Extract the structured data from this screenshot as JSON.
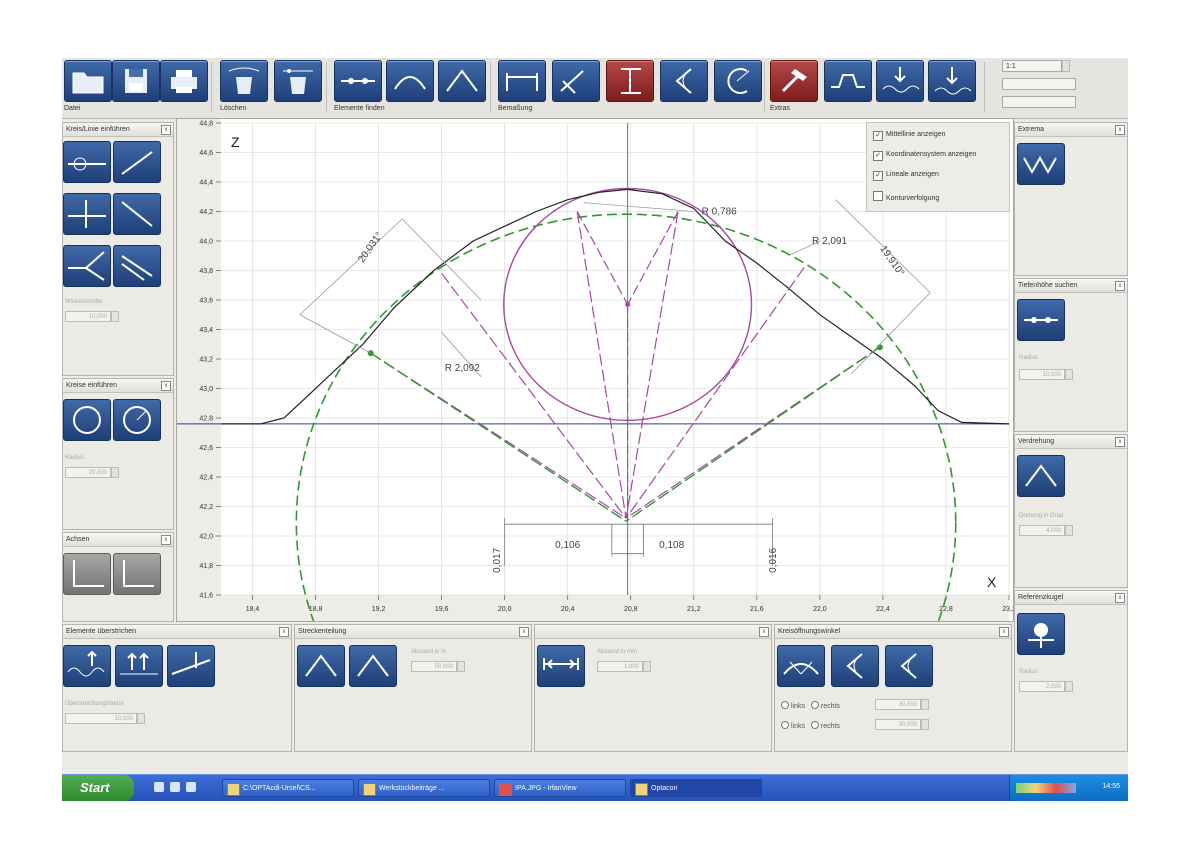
{
  "toolbar": {
    "groups": [
      "Datei",
      "Löschen",
      "Elemente finden",
      "Bemaßung",
      "Extras"
    ],
    "scale_value": "1:1"
  },
  "overlay": {
    "options": [
      {
        "label": "Mittellinie anzeigen",
        "checked": true
      },
      {
        "label": "Koordinatensystem anzeigen",
        "checked": true
      },
      {
        "label": "Lineale anzeigen",
        "checked": true
      },
      {
        "label": "Konturverfolgung",
        "checked": false
      }
    ],
    "check_mark": "✓"
  },
  "left_panels": [
    {
      "title": "Kreis/Linie einführen",
      "field_label": "Winkelschritte",
      "value": "10,000"
    },
    {
      "title": "Kreise einführen",
      "field_label": "Radius",
      "value": "20,000"
    },
    {
      "title": "Achsen",
      "field_label": "",
      "value": ""
    }
  ],
  "right_panels": [
    {
      "title": "Extrema",
      "field_label": "",
      "value": ""
    },
    {
      "title": "Tiefenhöhe suchen",
      "field_label": "Radius",
      "value": "10,000"
    },
    {
      "title": "Verdrehung",
      "field_label": "Drehung in Grad",
      "value": "4,000"
    },
    {
      "title": "Referenzkugel",
      "field_label": "Radius",
      "value": "2,000"
    }
  ],
  "bottom_panels": [
    {
      "title": "Elemente überstrichen",
      "field_label": "Überstreichungsfaktor",
      "value": "10,000"
    },
    {
      "title": "Streckenteilung",
      "field_label": "Abstand in %",
      "value": "50,000"
    },
    {
      "title": "",
      "field_label": "Abstand in mm",
      "value": "1,000"
    },
    {
      "title": "Kreisöffnungswinkel",
      "field_label": "",
      "value": ""
    }
  ],
  "bottom_radio": {
    "left_label": "links",
    "right_label": "rechts",
    "row1_value": "30,000",
    "row2_value": "30,000"
  },
  "taskbar": {
    "start": "Start",
    "tasks": [
      "C:\\OPTAcdi-Ursel\\CS...",
      "Werkstückbeiträge ...",
      "IPA.JPG - IrfanView",
      "Optacon"
    ],
    "clock": "14:55"
  },
  "chart_data": {
    "type": "line",
    "xlabel": "X",
    "ylabel": "Z",
    "xlim": [
      18.2,
      23.2
    ],
    "ylim": [
      41.6,
      44.8
    ],
    "x_ticks": [
      "18,4",
      "18,8",
      "19,2",
      "19,6",
      "20,0",
      "20,4",
      "20,8",
      "21,2",
      "21,6",
      "22,0",
      "22,4",
      "22,8",
      "23,2"
    ],
    "x_tick_values": [
      18.4,
      18.8,
      19.2,
      19.6,
      20.0,
      20.4,
      20.8,
      21.2,
      21.6,
      22.0,
      22.4,
      22.8,
      23.2
    ],
    "y_ticks": [
      "41,6",
      "41,8",
      "42,0",
      "42,2",
      "42,4",
      "42,6",
      "42,8",
      "43,0",
      "43,2",
      "43,4",
      "43,6",
      "43,8",
      "44,0",
      "44,2",
      "44,4",
      "44,6",
      "44,8"
    ],
    "y_tick_values": [
      41.6,
      41.8,
      42.0,
      42.2,
      42.4,
      42.6,
      42.8,
      43.0,
      43.2,
      43.4,
      43.6,
      43.8,
      44.0,
      44.2,
      44.4,
      44.6,
      44.8
    ],
    "baseline_z": 42.76,
    "centerline_x": 20.78,
    "series": [
      {
        "values_x": [
          18.2,
          18.45,
          18.6,
          18.75,
          18.9,
          19.1,
          19.3,
          19.55,
          19.8,
          20.0,
          20.2,
          20.4,
          20.6,
          20.78,
          21.0,
          21.2,
          21.4,
          21.6,
          21.8,
          22.0,
          22.2,
          22.4,
          22.6,
          22.75,
          22.9,
          23.2
        ],
        "values_z": [
          42.76,
          42.76,
          42.8,
          42.95,
          43.1,
          43.3,
          43.55,
          43.8,
          44.0,
          44.1,
          44.2,
          44.28,
          44.33,
          44.35,
          44.32,
          44.22,
          44.0,
          43.85,
          43.68,
          43.5,
          43.35,
          43.2,
          43.02,
          42.85,
          42.77,
          42.76
        ],
        "color": "#222222"
      },
      {
        "circle_cx": 20.77,
        "circle_cz": 42.09,
        "r": 2.092,
        "color": "#2e9a2e"
      },
      {
        "circle_cx": 20.78,
        "circle_cz": 43.57,
        "r": 0.786,
        "color": "#a54a9f"
      }
    ],
    "annotations": [
      "R 0,786",
      "R 2,091",
      "R 2,092",
      "20,031°",
      "19,910°",
      "0,106",
      "0,108",
      "0,017",
      "0,016"
    ]
  }
}
